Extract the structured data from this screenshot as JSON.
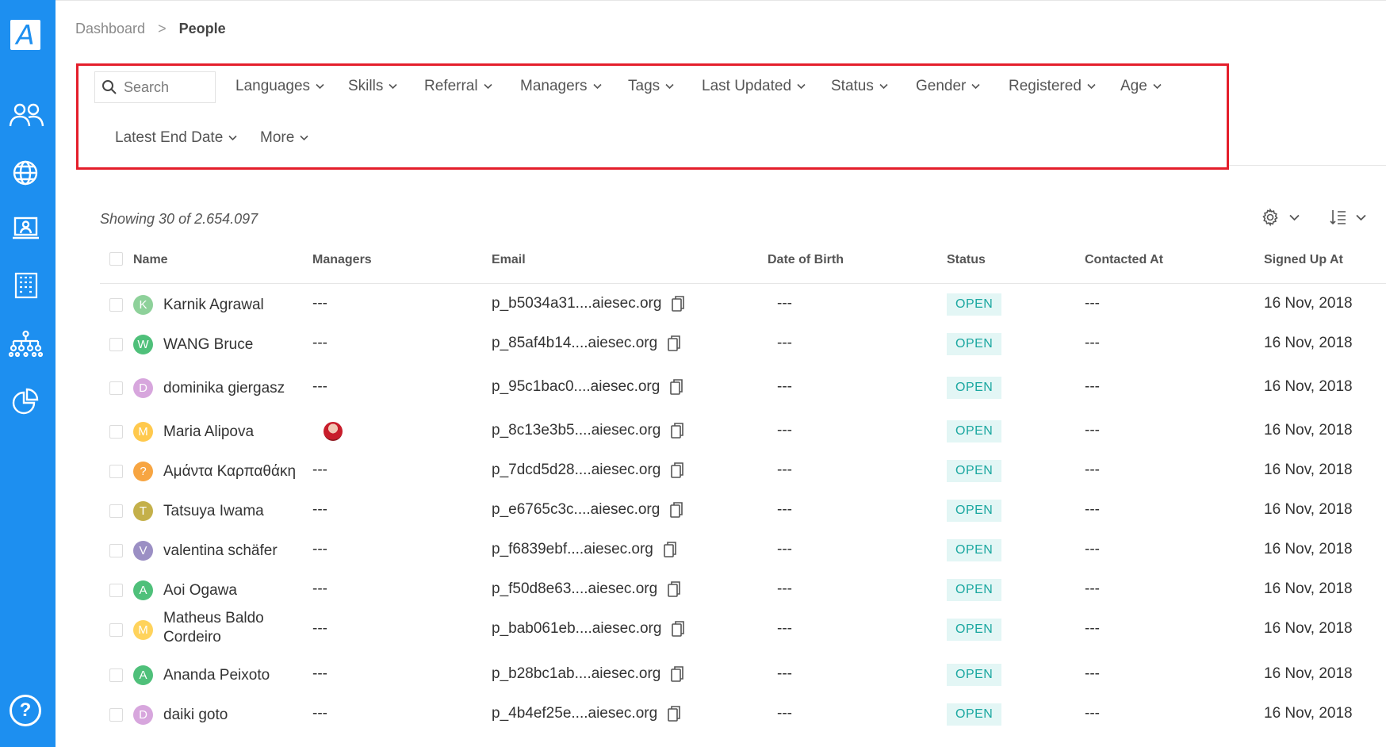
{
  "app": {
    "logo_letter": "A"
  },
  "sidebar": {
    "items": [
      {
        "icon": "people-icon"
      },
      {
        "icon": "globe-icon"
      },
      {
        "icon": "presentation-icon"
      },
      {
        "icon": "building-icon"
      },
      {
        "icon": "org-chart-icon"
      },
      {
        "icon": "pie-chart-icon"
      }
    ],
    "help_label": "?"
  },
  "breadcrumb": {
    "parent": "Dashboard",
    "separator": ">",
    "current": "People"
  },
  "filters": {
    "search_placeholder": "Search",
    "items": [
      "Languages",
      "Skills",
      "Referral",
      "Managers",
      "Tags",
      "Last Updated",
      "Status",
      "Gender",
      "Registered",
      "Age",
      "Latest End Date",
      "More"
    ]
  },
  "summary": {
    "text": "Showing 30 of 2.654.097"
  },
  "table": {
    "columns": [
      "Name",
      "Managers",
      "Email",
      "Date of Birth",
      "Status",
      "Contacted At",
      "Signed Up At"
    ],
    "rows": [
      {
        "initial": "K",
        "color": "#8ed19a",
        "name": "Karnik Agrawal",
        "managers": "---",
        "email": "p_b5034a31....aiesec.org",
        "dob": "---",
        "status": "OPEN",
        "contacted": "---",
        "signed": "16 Nov, 2018"
      },
      {
        "initial": "W",
        "color": "#4fc07a",
        "name": "WANG Bruce",
        "managers": "---",
        "email": "p_85af4b14....aiesec.org",
        "dob": "---",
        "status": "OPEN",
        "contacted": "---",
        "signed": "16 Nov, 2018"
      },
      {
        "initial": "D",
        "color": "#d7a6dd",
        "name": "dominika giergasz",
        "managers": "---",
        "email": "p_95c1bac0....aiesec.org",
        "dob": "---",
        "status": "OPEN",
        "contacted": "---",
        "signed": "16 Nov, 2018"
      },
      {
        "initial": "M",
        "color": "#ffc94d",
        "name": "Maria Alipova",
        "managers": "",
        "email": "p_8c13e3b5....aiesec.org",
        "dob": "---",
        "status": "OPEN",
        "contacted": "---",
        "signed": "16 Nov, 2018"
      },
      {
        "initial": "?",
        "color": "#f7a542",
        "name": "Αμάντα Καρπαθάκη",
        "managers": "---",
        "email": "p_7dcd5d28....aiesec.org",
        "dob": "---",
        "status": "OPEN",
        "contacted": "---",
        "signed": "16 Nov, 2018"
      },
      {
        "initial": "T",
        "color": "#c4b04a",
        "name": "Tatsuya Iwama",
        "managers": "---",
        "email": "p_e6765c3c....aiesec.org",
        "dob": "---",
        "status": "OPEN",
        "contacted": "---",
        "signed": "16 Nov, 2018"
      },
      {
        "initial": "V",
        "color": "#9b8fc4",
        "name": "valentina schäfer",
        "managers": "---",
        "email": "p_f6839ebf....aiesec.org",
        "dob": "---",
        "status": "OPEN",
        "contacted": "---",
        "signed": "16 Nov, 2018"
      },
      {
        "initial": "A",
        "color": "#4fc07a",
        "name": "Aoi Ogawa",
        "managers": "---",
        "email": "p_f50d8e63....aiesec.org",
        "dob": "---",
        "status": "OPEN",
        "contacted": "---",
        "signed": "16 Nov, 2018"
      },
      {
        "initial": "M",
        "color": "#ffd35c",
        "name": "Matheus Baldo",
        "name2": "Cordeiro",
        "managers": "---",
        "email": "p_bab061eb....aiesec.org",
        "dob": "---",
        "status": "OPEN",
        "contacted": "---",
        "signed": "16 Nov, 2018"
      },
      {
        "initial": "A",
        "color": "#4fc07a",
        "name": "Ananda Peixoto",
        "managers": "---",
        "email": "p_b28bc1ab....aiesec.org",
        "dob": "---",
        "status": "OPEN",
        "contacted": "---",
        "signed": "16 Nov, 2018"
      },
      {
        "initial": "D",
        "color": "#d7a6dd",
        "name": "daiki goto",
        "managers": "---",
        "email": "p_4b4ef25e....aiesec.org",
        "dob": "---",
        "status": "OPEN",
        "contacted": "---",
        "signed": "16 Nov, 2018"
      }
    ]
  },
  "toolbar": {
    "settings_icon": "gear-icon",
    "sort_icon": "sort-icon"
  },
  "colors": {
    "sidebar": "#1d8ff0",
    "highlight_border": "#e41e2b",
    "status_text": "#1aa7a0",
    "status_bg": "#e3f6f5"
  }
}
